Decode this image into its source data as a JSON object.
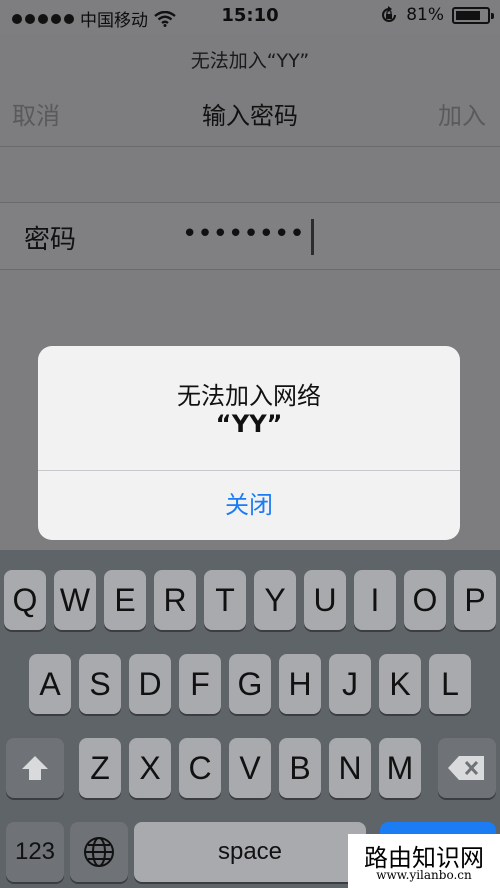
{
  "status_bar": {
    "carrier": "中国移动",
    "time": "15:10",
    "battery": "81%",
    "battery_level": 0.81,
    "icons": [
      "signal-dots-icon",
      "wifi-icon",
      "rotation-lock-icon",
      "battery-icon"
    ]
  },
  "nav": {
    "prompt": "无法加入“YY”",
    "cancel": "取消",
    "title": "输入密码",
    "join": "加入"
  },
  "password": {
    "label": "密码",
    "value": "••••••••"
  },
  "alert": {
    "title": "无法加入网络",
    "subtitle": "“YY”",
    "close": "关闭"
  },
  "keyboard": {
    "row1": [
      "Q",
      "W",
      "E",
      "R",
      "T",
      "Y",
      "U",
      "I",
      "O",
      "P"
    ],
    "row2": [
      "A",
      "S",
      "D",
      "F",
      "G",
      "H",
      "J",
      "K",
      "L"
    ],
    "row3": [
      "Z",
      "X",
      "C",
      "V",
      "B",
      "N",
      "M"
    ],
    "numbers_key": "123",
    "space_key": "space",
    "icons": [
      "shift-icon",
      "delete-icon",
      "globe-icon"
    ]
  },
  "watermark": {
    "text": "路由知识网",
    "url": "www.yilanbo.cn"
  },
  "colors": {
    "accent": "#1b7cf4",
    "dim_background": "#7d7d7f",
    "keyboard": "#5f6468"
  }
}
